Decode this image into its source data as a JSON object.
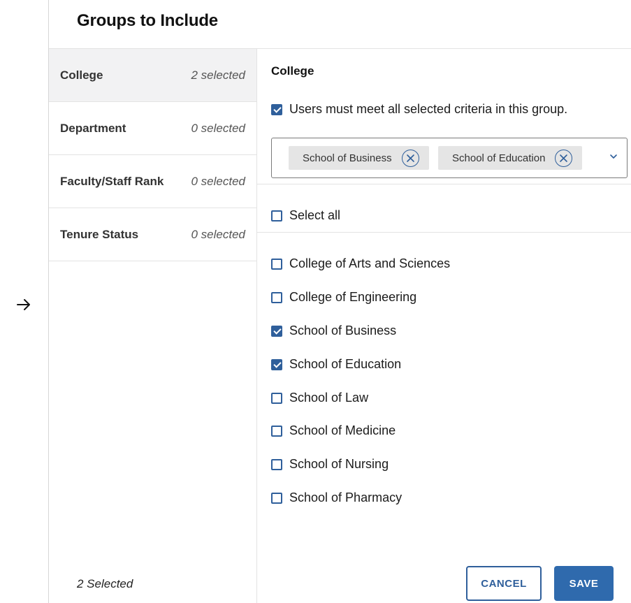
{
  "header": {
    "title": "Groups to Include"
  },
  "categories": [
    {
      "name": "College",
      "count": "2 selected",
      "active": true
    },
    {
      "name": "Department",
      "count": "0 selected",
      "active": false
    },
    {
      "name": "Faculty/Staff Rank",
      "count": "0 selected",
      "active": false
    },
    {
      "name": "Tenure Status",
      "count": "0 selected",
      "active": false
    }
  ],
  "summary": "2 Selected",
  "panel": {
    "title": "College",
    "must_meet_label": "Users must meet all selected criteria in this group.",
    "must_meet_checked": true,
    "chips": [
      "School of Business",
      "School of Education"
    ],
    "select_all_label": "Select all",
    "options": [
      {
        "label": "College of Arts and Sciences",
        "checked": false
      },
      {
        "label": "College of Engineering",
        "checked": false
      },
      {
        "label": "School of Business",
        "checked": true
      },
      {
        "label": "School of Education",
        "checked": true
      },
      {
        "label": "School of Law",
        "checked": false
      },
      {
        "label": "School of Medicine",
        "checked": false
      },
      {
        "label": "School of Nursing",
        "checked": false
      },
      {
        "label": "School of Pharmacy",
        "checked": false
      }
    ]
  },
  "buttons": {
    "cancel": "CANCEL",
    "save": "SAVE"
  },
  "colors": {
    "accent": "#2f5f9b",
    "save_bg": "#2f6aad",
    "active_row": "#f2f2f3"
  },
  "icons": {
    "rail": "arrow-right-icon",
    "chip_remove": "close-circle-icon",
    "dropdown": "chevron-down-icon"
  }
}
